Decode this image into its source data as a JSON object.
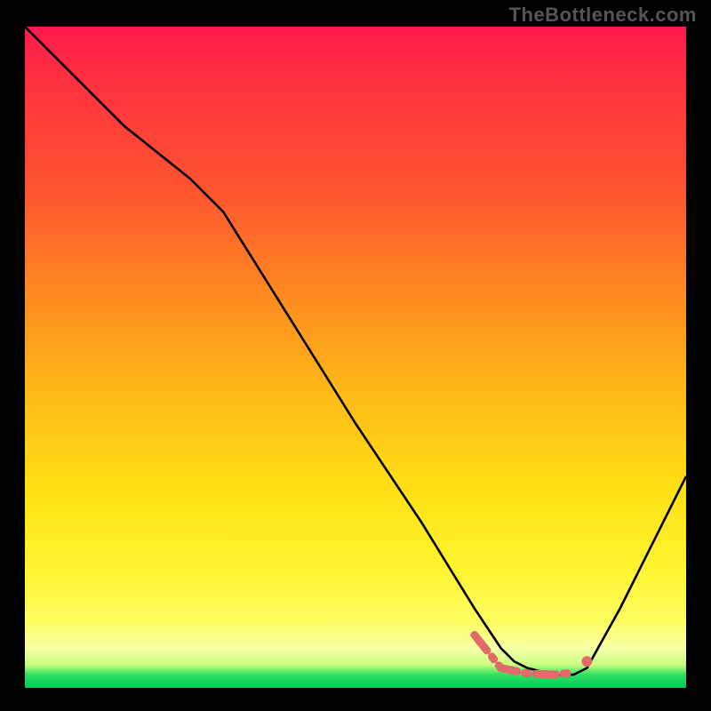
{
  "watermark": "TheBottleneck.com",
  "chart_data": {
    "type": "line",
    "title": "",
    "xlabel": "",
    "ylabel": "",
    "xlim": [
      0,
      100
    ],
    "ylim": [
      0,
      100
    ],
    "series": [
      {
        "name": "bottleneck-curve",
        "color": "#000000",
        "x": [
          0,
          5,
          15,
          25,
          30,
          40,
          50,
          60,
          68,
          72,
          74,
          76,
          80,
          83,
          85,
          90,
          95,
          100
        ],
        "values": [
          100,
          95,
          85,
          77,
          72,
          56,
          40,
          25,
          12,
          6,
          4,
          3,
          2,
          2,
          3,
          12,
          22,
          32
        ]
      },
      {
        "name": "optimal-marker",
        "color": "#e26a6a",
        "style": "thick-dashed",
        "x": [
          68,
          72,
          76,
          78,
          80,
          82,
          83
        ],
        "values": [
          8,
          3,
          2.2,
          2.1,
          2,
          2.2,
          2.5
        ]
      }
    ],
    "markers": [
      {
        "name": "optimal-dot",
        "x": 85,
        "y": 4,
        "color": "#e26a6a"
      }
    ]
  },
  "colors": {
    "grid_bg_top": "#ff1a4d",
    "grid_bg_bottom": "#00c85a",
    "curve": "#000000",
    "marker": "#e26a6a"
  }
}
